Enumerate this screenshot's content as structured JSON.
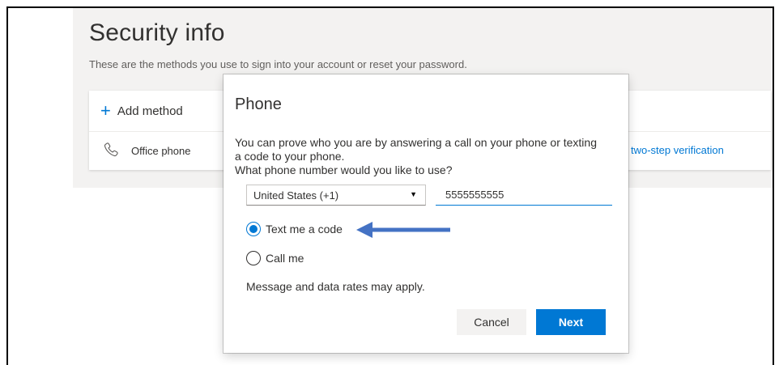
{
  "page": {
    "title": "Security info",
    "subtitle": "These are the methods you use to sign into your account or reset your password."
  },
  "methods": {
    "add_method_label": "Add method",
    "add_icon": "plus-icon",
    "items": [
      {
        "icon": "phone-icon",
        "label": "Office phone"
      }
    ],
    "enable_link": "ble two-step verification"
  },
  "dialog": {
    "title": "Phone",
    "description": "You can prove who you are by answering a call on your phone or texting a code to your phone.",
    "question": "What phone number would you like to use?",
    "country_select": {
      "selected": "United States (+1)"
    },
    "phone_input": {
      "value": "5555555555"
    },
    "options": [
      {
        "label": "Text me a code",
        "checked": true
      },
      {
        "label": "Call me",
        "checked": false
      }
    ],
    "note": "Message and data rates may apply.",
    "cancel_label": "Cancel",
    "next_label": "Next"
  },
  "colors": {
    "accent": "#0078d4",
    "annotation_arrow": "#4472c4",
    "page_bg": "#f3f2f1"
  }
}
